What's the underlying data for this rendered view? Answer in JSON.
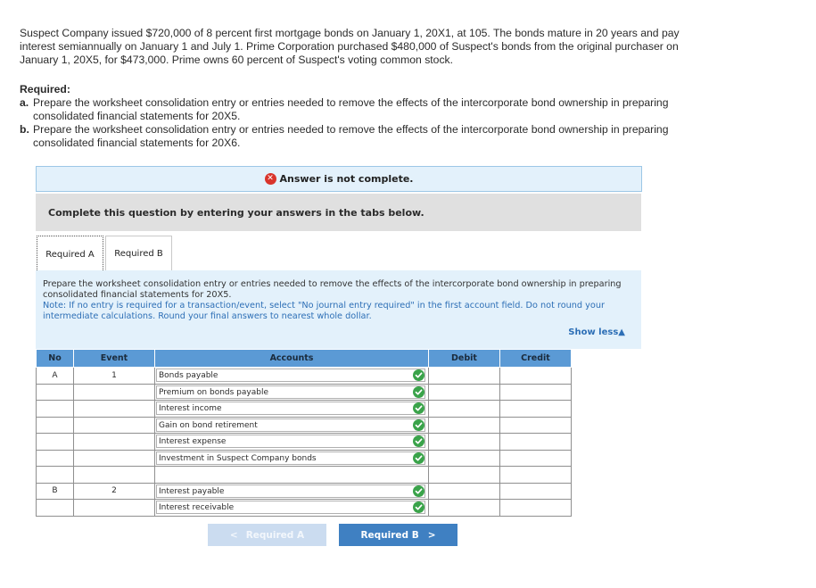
{
  "problem": {
    "text": "Suspect Company issued $720,000 of 8 percent first mortgage bonds on January 1, 20X1, at 105. The bonds mature in 20 years and pay interest semiannually on January 1 and July 1. Prime Corporation purchased $480,000 of Suspect's bonds from the original purchaser on January 1, 20X5, for $473,000. Prime owns 60 percent of Suspect's voting common stock."
  },
  "required": {
    "title": "Required:",
    "items": [
      {
        "letter": "a.",
        "text": "Prepare the worksheet consolidation entry or entries needed to remove the effects of the intercorporate bond ownership in preparing consolidated financial statements for 20X5."
      },
      {
        "letter": "b.",
        "text": "Prepare the worksheet consolidation entry or entries needed to remove the effects of the intercorporate bond ownership in preparing consolidated financial statements for 20X6."
      }
    ]
  },
  "banner": {
    "icon": "x-circle-icon",
    "text": "Answer is not complete."
  },
  "instruction": "Complete this question by entering your answers in the tabs below.",
  "tabs": [
    {
      "label": "Required A",
      "active": true
    },
    {
      "label": "Required B",
      "active": false
    }
  ],
  "panel": {
    "text": "Prepare the worksheet consolidation entry or entries needed to remove the effects of the intercorporate bond ownership in preparing consolidated financial statements for 20X5.",
    "note": "Note: If no entry is required for a transaction/event, select \"No journal entry required\" in the first account field. Do not round your intermediate calculations. Round your final answers to nearest whole dollar.",
    "show_less": "Show less",
    "show_less_icon": "triangle-up-icon"
  },
  "table": {
    "headers": {
      "no": "No",
      "event": "Event",
      "accounts": "Accounts",
      "debit": "Debit",
      "credit": "Credit"
    },
    "rows": [
      {
        "no": "A",
        "event": "1",
        "account": "Bonds payable",
        "check": true
      },
      {
        "no": "",
        "event": "",
        "account": "Premium on bonds payable",
        "check": true
      },
      {
        "no": "",
        "event": "",
        "account": "Interest income",
        "check": true
      },
      {
        "no": "",
        "event": "",
        "account": "Gain on bond retirement",
        "check": true
      },
      {
        "no": "",
        "event": "",
        "account": "Interest expense",
        "check": true
      },
      {
        "no": "",
        "event": "",
        "account": "Investment in Suspect Company bonds",
        "check": true
      },
      {
        "no": "",
        "event": "",
        "account": "",
        "check": false
      },
      {
        "no": "B",
        "event": "2",
        "account": "Interest payable",
        "check": true
      },
      {
        "no": "",
        "event": "",
        "account": "Interest receivable",
        "check": true
      }
    ]
  },
  "nav": {
    "prev": "Required A",
    "next": "Required B"
  },
  "colors": {
    "accent": "#3f80c2",
    "header": "#5b9ad5",
    "check": "#3aa34a",
    "error": "#d9342b",
    "panel": "#e3f1fb"
  }
}
